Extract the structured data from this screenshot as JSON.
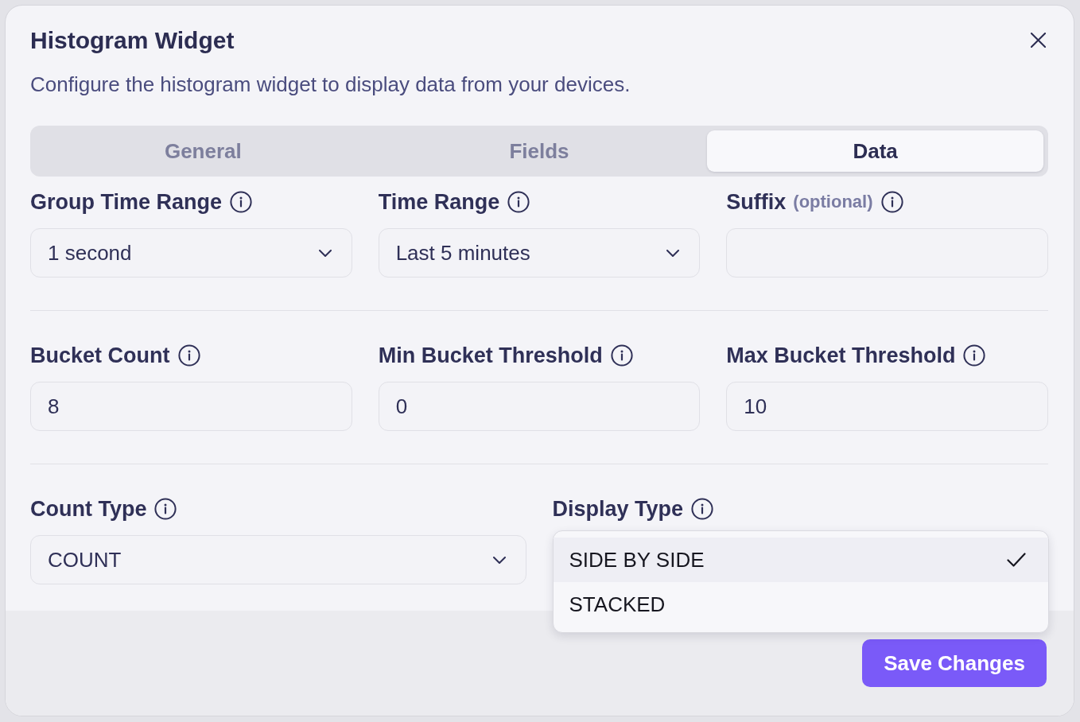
{
  "dialog": {
    "title": "Histogram Widget",
    "description": "Configure the histogram widget to display data from your devices."
  },
  "tabs": [
    {
      "label": "General",
      "selected": false
    },
    {
      "label": "Fields",
      "selected": false
    },
    {
      "label": "Data",
      "selected": true
    }
  ],
  "sections": [
    {
      "fields": [
        {
          "label": "Group Time Range",
          "kind": "select",
          "value": "1 second"
        },
        {
          "label": "Time Range",
          "kind": "select",
          "value": "Last 5 minutes"
        },
        {
          "label": "Suffix",
          "hint": "(optional)",
          "kind": "input"
        }
      ]
    },
    {
      "fields": [
        {
          "label": "Bucket Count",
          "kind": "input",
          "value": "8"
        },
        {
          "label": "Min Bucket Threshold",
          "kind": "input",
          "value": "0"
        },
        {
          "label": "Max Bucket Threshold",
          "kind": "input",
          "value": "10"
        }
      ]
    },
    {
      "fields": [
        {
          "label": "Count Type",
          "kind": "select",
          "value": "COUNT"
        },
        {
          "label": "Display Type",
          "kind": "menu",
          "options": [
            {
              "label": "SIDE BY SIDE",
              "selected": true
            },
            {
              "label": "STACKED",
              "selected": false
            }
          ]
        }
      ]
    }
  ],
  "footer": {
    "button": "Save Changes"
  }
}
